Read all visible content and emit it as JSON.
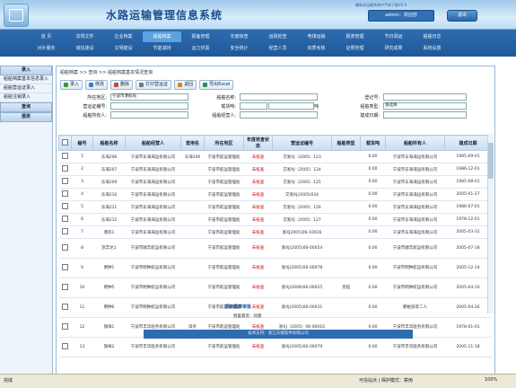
{
  "header": {
    "title": "水路运输管理信息系统",
    "note": "最新本运输系统中手册下载V2.0",
    "user": "admin：欢迎您",
    "exit": "退出"
  },
  "nav": {
    "row1": [
      "首 页",
      "法规文件",
      "企业档案",
      "船舶档案",
      "报备管理",
      "年度核查",
      "运政检查",
      "电煤运输",
      "报表管理",
      "节日调运",
      "船舶日志"
    ],
    "row2": [
      "对外服务",
      "诚信建设",
      "文明建设",
      "节能减排",
      "运力供需",
      "安全统计",
      "经营人员",
      "资质考核",
      "证照管理",
      "研究成果",
      "系统设置"
    ],
    "active_index": 3
  },
  "sidebar": {
    "head1": "录入",
    "items": [
      "船舶档案基本信息录入",
      "船舶营运证录入",
      "船舶注销录入"
    ],
    "head2": "查询",
    "head3": "报表"
  },
  "main": {
    "breadcrumb": "船舶档案 >> 查询 >> 船舶档案基本情况查询",
    "toolbar": [
      "录入",
      "修改",
      "删除",
      "打印营运证",
      "退回",
      "导出Excel"
    ],
    "form": {
      "area_label": "所在地区:",
      "area_value": "宁波市港航局",
      "shipname_label": "船舶名称:",
      "regno_label": "登记号:",
      "certno_label": "营运证编号:",
      "tonnage_label": "载货吨:",
      "tonnage_unit": "吨",
      "type_label": "船舶类型:",
      "type_value": "请选择",
      "owner_label": "船舶所有人:",
      "operator_label": "船舶经营人:",
      "builddate_label": "建成日期:"
    },
    "table": {
      "headers": [
        "",
        "编号",
        "船舶名称",
        "船舶经营人",
        "曾用名",
        "所在地区",
        "年度核查状态",
        "营运证编号",
        "船舶类型",
        "载货吨",
        "船舶所有人",
        "建成日期"
      ],
      "rows": [
        [
          "1",
          "东海206",
          "宁波市东海海运有限公司",
          "东海206",
          "宁波市航运管理处",
          "未核查",
          "交浙XJ（2005）123",
          "",
          "0.00",
          "宁波市东海海运有限公司",
          "1985-09-01"
        ],
        [
          "2",
          "东海207",
          "宁波市东海海运有限公司",
          "",
          "宁波市航运管理处",
          "未核查",
          "交浙XJ（2005）124",
          "",
          "0.00",
          "宁波市东海海运有限公司",
          "1986-12-01"
        ],
        [
          "3",
          "东海209",
          "宁波市东海海运有限公司",
          "",
          "宁波市航运管理处",
          "未核查",
          "交浙XJ（2005）125",
          "",
          "0.00",
          "宁波市东海海运有限公司",
          "1985-08-01"
        ],
        [
          "4",
          "东海210",
          "宁波市东海海运有限公司",
          "",
          "宁波市航运管理处",
          "未核查",
          "交浙XJ(2005)034",
          "",
          "0.00",
          "宁波市东海海运有限公司",
          "2005-01-27"
        ],
        [
          "5",
          "东海211",
          "宁波市东海海运有限公司",
          "",
          "宁波市航运管理处",
          "未核查",
          "交浙XJ（2005）126",
          "",
          "0.00",
          "宁波市东海海运有限公司",
          "1986-07-01"
        ],
        [
          "6",
          "东海212",
          "宁波市东海海运有限公司",
          "",
          "宁波市航运管理处",
          "未核查",
          "交浙XJ（2005）127",
          "",
          "0.00",
          "宁波市东海海运有限公司",
          "1978-12-01"
        ],
        [
          "7",
          "港舟1",
          "宁波市东海海运有限公司",
          "",
          "宁波市航运管理处",
          "未核查",
          "浙XJ2005)06-10016",
          "",
          "0.00",
          "宁波市东海海运有限公司",
          "2005-03-31"
        ],
        [
          "8",
          "凯丰达1",
          "宁波市顺丰航运有限公司",
          "",
          "宁波市航运管理处",
          "未核查",
          "浙XJ(2005)06-00054",
          "",
          "0.00",
          "宁波市顺丰航运有限公司",
          "2005-07-18"
        ],
        [
          "9",
          "明钟1",
          "宁波市明钟航运有限公司",
          "",
          "宁波市航运管理处",
          "未核查",
          "浙XJ(2005)06-00078",
          "",
          "0.00",
          "宁波市明钟航运有限公司",
          "2005-12-14"
        ],
        [
          "10",
          "明钟5",
          "宁波市明钟航运有限公司",
          "",
          "宁波市航运管理处",
          "未核查",
          "浙XJ(2008)06-00025",
          "货船",
          "0.00",
          "宁波市明钟航运有限公司",
          "2005-04-10"
        ],
        [
          "11",
          "明钟6",
          "宁波市明钟航运有限公司",
          "",
          "宁波市航运管理处",
          "未核查",
          "浙XJ(2005)06-00031",
          "",
          "0.00",
          "鄞柏浩等二人",
          "2005-04-26"
        ],
        [
          "12",
          "旗祥1",
          "宁波市丰华船务有限公司",
          "母亲",
          "宁波市航运管理处",
          "未核查",
          "浙XJ（2005）06-00016",
          "",
          "0.00",
          "宁波市丰华船务有限公司",
          "1978-01-01"
        ],
        [
          "13",
          "旗祥2",
          "宁波市丰华船务有限公司",
          "",
          "宁波市航运管理处",
          "未核查",
          "浙XJ(2005)06-00079",
          "",
          "0.00",
          "宁波市丰华船务有限公司",
          "2005-11-18"
        ]
      ]
    },
    "detail": {
      "title": "项目概算审批",
      "opinion_label": "批复意见：同意"
    },
    "footer": "技术支持：浙江天搜软件有限公司"
  },
  "status": {
    "left": "完成",
    "right": "可信站点 | 保护模式：禁用",
    "zoom": "100%"
  },
  "colors": {
    "nav_bg": "#2e6cb0",
    "status_red": "#d40000"
  }
}
